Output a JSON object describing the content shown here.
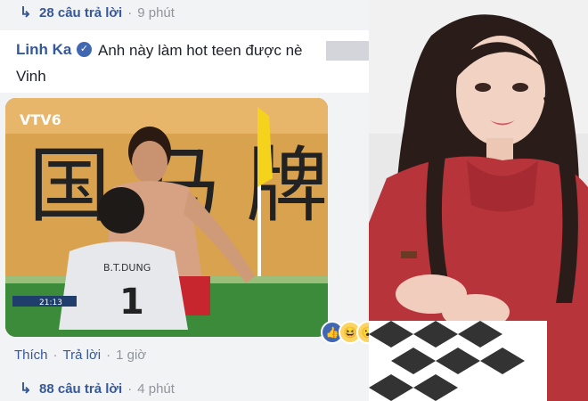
{
  "thread": {
    "replies_top": {
      "count_label": "28 câu trả lời",
      "time": "9 phút"
    },
    "comment": {
      "author": "Linh Ka",
      "text_line1": "Anh này làm hot teen được nè",
      "text_line2": "Vinh",
      "actions": {
        "like": "Thích",
        "reply": "Trả lời",
        "time": "1 giờ"
      }
    },
    "replies_bottom": {
      "count_label": "88 câu trả lời",
      "time": "4 phút"
    }
  },
  "video_frame": {
    "channel": "VTV6",
    "player_number": "1",
    "player_name": "B.T.DUNG",
    "timer": "21:13",
    "banner_chars": [
      "国",
      "马",
      "牌"
    ]
  },
  "reactions": [
    "like-icon",
    "haha-icon",
    "wow-icon"
  ],
  "colors": {
    "link": "#365899",
    "like": "#4267b2",
    "panel_bg": "#f2f3f5"
  }
}
